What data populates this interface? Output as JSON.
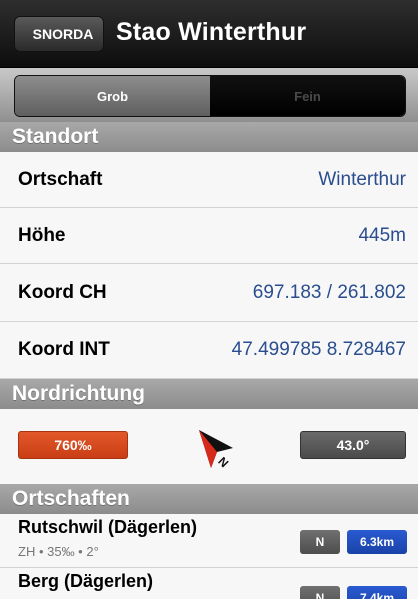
{
  "navbar": {
    "back_label": "SNORDA",
    "title": "Stao Winterthur"
  },
  "segments": {
    "items": [
      {
        "label": "Grob",
        "selected": true
      },
      {
        "label": "Fein",
        "selected": false
      }
    ]
  },
  "standort": {
    "header": "Standort",
    "rows": [
      {
        "label": "Ortschaft",
        "value": "Winterthur"
      },
      {
        "label": "Höhe",
        "value": "445m"
      },
      {
        "label": "Koord CH",
        "value": "697.183 / 261.802"
      },
      {
        "label": "Koord INT",
        "value": "47.499785 8.728467"
      }
    ]
  },
  "nordrichtung": {
    "header": "Nordrichtung",
    "declination": "760‰",
    "angle": "43.0°",
    "compass_icon": "north-arrow-icon",
    "colors": {
      "declination_bg": "#d9481c",
      "angle_bg": "#5a5a5a"
    }
  },
  "ortschaften": {
    "header": "Ortschaften",
    "items": [
      {
        "name": "Rutschwil (Dägerlen)",
        "meta": "ZH • 35‰ • 2°",
        "dir": "N",
        "distance": "6.3km"
      },
      {
        "name": "Berg (Dägerlen)",
        "meta": "",
        "dir": "N",
        "distance": "7.4km"
      }
    ]
  },
  "colors": {
    "link_value": "#2a4d8f",
    "distance_badge": "#2a5bd1"
  }
}
